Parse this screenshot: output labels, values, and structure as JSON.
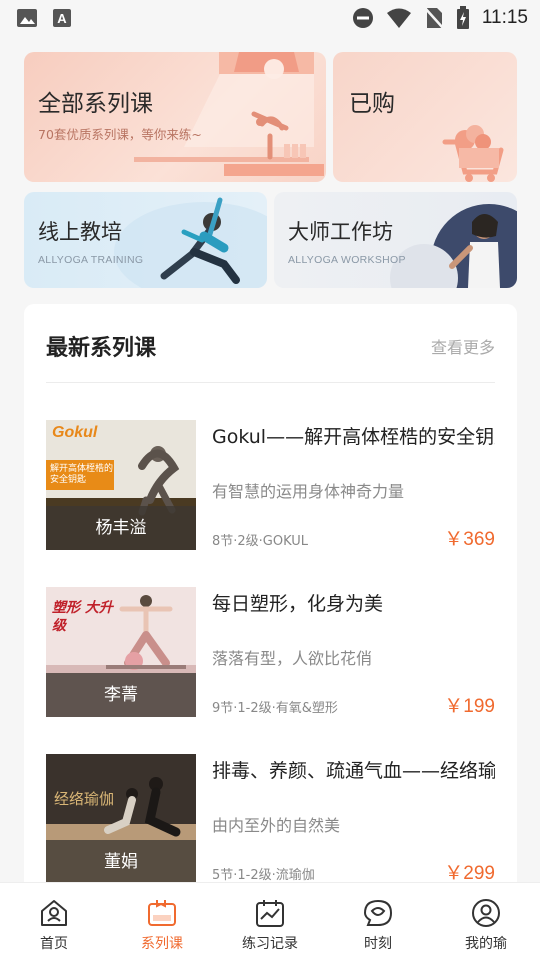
{
  "status_bar": {
    "time": "11:15"
  },
  "categories": [
    {
      "title": "全部系列课",
      "subtitle": "70套优质系列课，等你来练~"
    },
    {
      "title": "已购"
    },
    {
      "title": "线上教培",
      "subtitle": "ALLYOGA TRAINING"
    },
    {
      "title": "大师工作坊",
      "subtitle": "ALLYOGA WORKSHOP"
    }
  ],
  "section": {
    "title": "最新系列课",
    "more": "查看更多"
  },
  "thumb_texts": [
    {
      "brand": "Gokul",
      "caption": "解开高体桎梏的 安全钥匙"
    },
    {
      "caption": "塑形 大升级"
    },
    {
      "caption": "经络瑜伽"
    }
  ],
  "courses": [
    {
      "title": "Gokul——解开高体桎梏的安全钥匙",
      "desc": "有智慧的运用身体神奇力量",
      "meta": "8节·2级·GOKUL",
      "price": "￥369",
      "teacher": "杨丰溢"
    },
    {
      "title": "每日塑形，化身为美",
      "desc": "落落有型，人欲比花俏",
      "meta": "9节·1-2级·有氧&塑形",
      "price": "￥199",
      "teacher": "李菁"
    },
    {
      "title": "排毒、养颜、疏通气血——经络瑜伽",
      "desc": "由内至外的自然美",
      "meta": "5节·1-2级·流瑜伽",
      "price": "￥299",
      "teacher": "董娟"
    }
  ],
  "nav": [
    {
      "label": "首页",
      "icon": "home-icon"
    },
    {
      "label": "系列课",
      "icon": "course-icon",
      "active": true
    },
    {
      "label": "练习记录",
      "icon": "record-icon"
    },
    {
      "label": "时刻",
      "icon": "moment-icon"
    },
    {
      "label": "我的瑜",
      "icon": "profile-icon"
    }
  ],
  "colors": {
    "accent": "#f06a2f",
    "price": "#f06a2f"
  }
}
